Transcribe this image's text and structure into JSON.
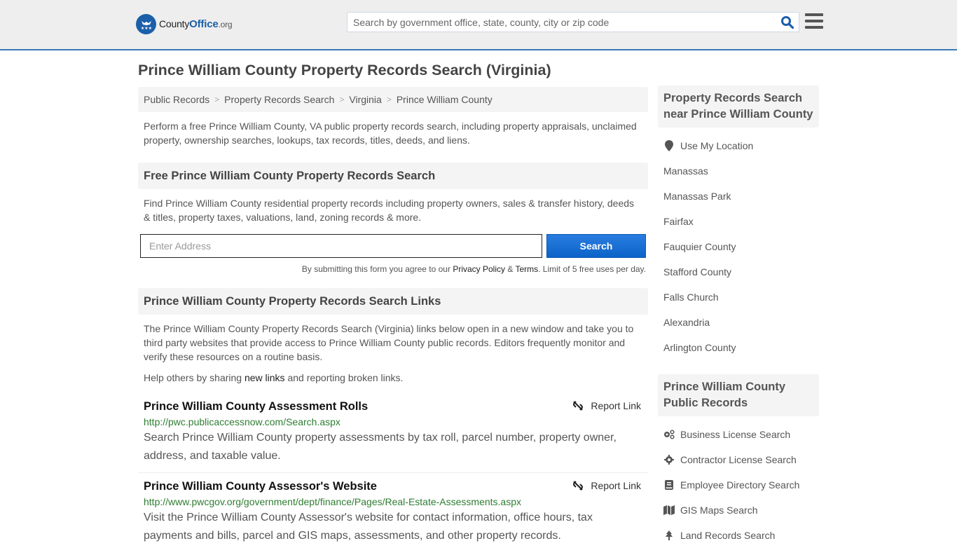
{
  "header": {
    "logo": {
      "name_prefix": "County",
      "name_main": "Office",
      "name_suffix": ".org"
    },
    "search_placeholder": "Search by government office, state, county, city or zip code",
    "colors": {
      "brand": "#1b5fa8",
      "header_border": "#3a7ab8"
    }
  },
  "page": {
    "title": "Prince William County Property Records Search (Virginia)",
    "breadcrumb": [
      {
        "label": "Public Records"
      },
      {
        "label": "Property Records Search"
      },
      {
        "label": "Virginia"
      },
      {
        "label": "Prince William County"
      }
    ],
    "intro": "Perform a free Prince William County, VA public property records search, including property appraisals, unclaimed property, ownership searches, lookups, tax records, titles, deeds, and liens."
  },
  "free_search": {
    "heading": "Free Prince William County Property Records Search",
    "description": "Find Prince William County residential property records including property owners, sales & transfer history, deeds & titles, property taxes, valuations, land, zoning records & more.",
    "address_placeholder": "Enter Address",
    "submit_label": "Search",
    "note_prefix": "By submitting this form you agree to our ",
    "privacy_label": "Privacy Policy",
    "note_amp": " & ",
    "terms_label": "Terms",
    "note_suffix": ". Limit of 5 free uses per day."
  },
  "links_section": {
    "heading": "Prince William County Property Records Search Links",
    "description": "The Prince William County Property Records Search (Virginia) links below open in a new window and take you to third party websites that provide access to Prince William County public records. Editors frequently monitor and verify these resources on a routine basis.",
    "help_prefix": "Help others by sharing ",
    "help_link": "new links",
    "help_suffix": " and reporting broken links.",
    "report_label": "Report Link",
    "items": [
      {
        "title": "Prince William County Assessment Rolls",
        "url": "http://pwc.publicaccessnow.com/Search.aspx",
        "description": "Search Prince William County property assessments by tax roll, parcel number, property owner, address, and taxable value."
      },
      {
        "title": "Prince William County Assessor's Website",
        "url": "http://www.pwcgov.org/government/dept/finance/Pages/Real-Estate-Assessments.aspx",
        "description": "Visit the Prince William County Assessor's website for contact information, office hours, tax payments and bills, parcel and GIS maps, assessments, and other property records."
      }
    ]
  },
  "sidebar": {
    "nearby_heading": "Property Records Search near Prince William County",
    "use_location": "Use My Location",
    "nearby": [
      "Manassas",
      "Manassas Park",
      "Fairfax",
      "Fauquier County",
      "Stafford County",
      "Falls Church",
      "Alexandria",
      "Arlington County"
    ],
    "public_records_heading": "Prince William County Public Records",
    "public_records": [
      {
        "label": "Business License Search",
        "icon": "gears-icon"
      },
      {
        "label": "Contractor License Search",
        "icon": "gear-icon"
      },
      {
        "label": "Employee Directory Search",
        "icon": "book-icon"
      },
      {
        "label": "GIS Maps Search",
        "icon": "map-icon"
      },
      {
        "label": "Land Records Search",
        "icon": "tree-icon"
      }
    ]
  }
}
